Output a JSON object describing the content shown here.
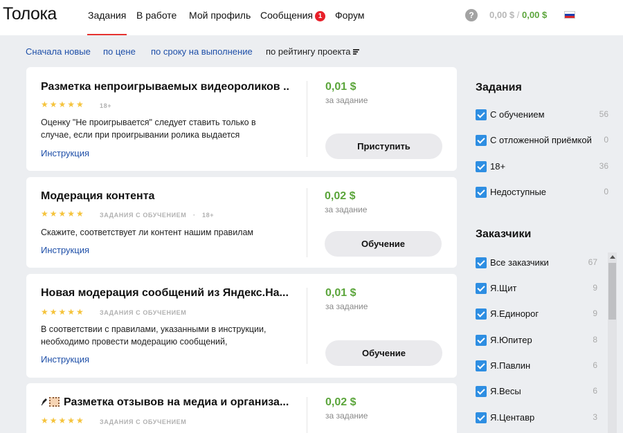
{
  "header": {
    "logo": "Толока",
    "nav": [
      {
        "label": "Задания"
      },
      {
        "label": "В работе"
      },
      {
        "label": "Мой профиль"
      },
      {
        "label": "Сообщения",
        "badge": "1"
      },
      {
        "label": "Форум"
      }
    ],
    "help": "?",
    "balance_pending": "0,00 $",
    "balance_sep": "/",
    "balance_available": "0,00 $",
    "flag_icon": "russia-flag-icon"
  },
  "sort": {
    "options": [
      "Сначала новые",
      "по цене",
      "по сроку на выполнение",
      "по рейтингу проекта"
    ],
    "current_index": 3
  },
  "tasks": [
    {
      "title": "Разметка непроигрываемых видеороликов ...",
      "stars": "★★★★★",
      "tags": [
        "18+"
      ],
      "desc": "Оценку \"Не проигрывается\" следует ставить только в случае, если при проигрывании ролика выдается",
      "link": "Инструкция",
      "price": "0,01 $",
      "price_note": "за задание",
      "button": "Приступить"
    },
    {
      "title": "Модерация контента",
      "stars": "★★★★★",
      "tags": [
        "ЗАДАНИЯ С ОБУЧЕНИЕМ",
        "·",
        "18+"
      ],
      "desc": "Скажите, соответствует ли контент нашим правилам",
      "link": "Инструкция",
      "price": "0,02 $",
      "price_note": "за задание",
      "button": "Обучение"
    },
    {
      "title": "Новая модерация сообщений из Яндекс.На...",
      "stars": "★★★★★",
      "tags": [
        "ЗАДАНИЯ С ОБУЧЕНИЕМ"
      ],
      "desc": "В соответствии с правилами, указанными в инструкции, необходимо провести модерацию сообщений,",
      "link": "Инструкция",
      "price": "0,01 $",
      "price_note": "за задание",
      "button": "Обучение"
    },
    {
      "title": "Разметка отзывов на медиа и организа...",
      "stars": "★★★★★",
      "tags": [
        "ЗАДАНИЯ С ОБУЧЕНИЕМ"
      ],
      "price": "0,02 $",
      "price_note": "за задание"
    }
  ],
  "sidebar": {
    "tasks_title": "Задания",
    "task_filters": [
      {
        "label": "С обучением",
        "count": "56"
      },
      {
        "label": "С отложенной приёмкой",
        "count": "0"
      },
      {
        "label": "18+",
        "count": "36"
      },
      {
        "label": "Недоступные",
        "count": "0"
      }
    ],
    "customers_title": "Заказчики",
    "customers": [
      {
        "label": "Все заказчики",
        "count": "67"
      },
      {
        "label": "Я.Щит",
        "count": "9"
      },
      {
        "label": "Я.Единорог",
        "count": "9"
      },
      {
        "label": "Я.Юпитер",
        "count": "8"
      },
      {
        "label": "Я.Павлин",
        "count": "6"
      },
      {
        "label": "Я.Весы",
        "count": "6"
      },
      {
        "label": "Я.Центавр",
        "count": "3"
      }
    ]
  },
  "colors": {
    "accent_red": "#e6322f",
    "price_green": "#5ba53b",
    "link_blue": "#1e4fa8",
    "checkbox_blue": "#2e8ee2",
    "star_yellow": "#f5c33b"
  }
}
